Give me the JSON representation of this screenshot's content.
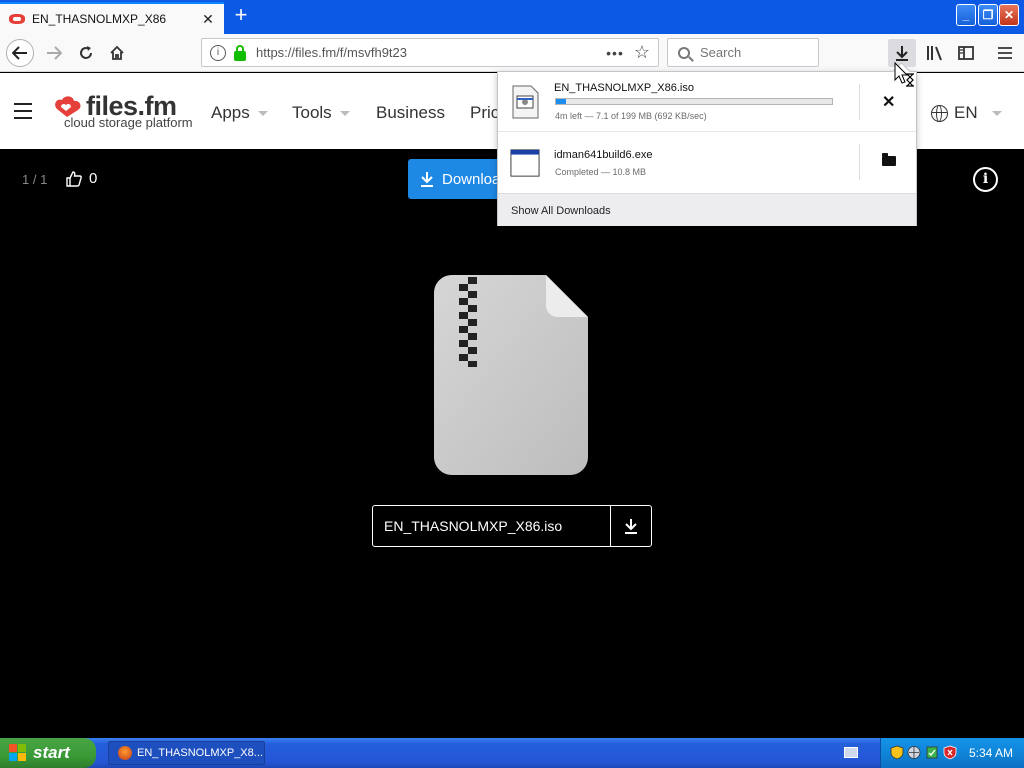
{
  "browser": {
    "tab_title": "EN_THASNOLMXP_X86",
    "tab_close": "✕",
    "new_tab": "+",
    "url": "https://files.fm/f/msvfh9t23",
    "url_more": "•••",
    "search_placeholder": "Search",
    "window_buttons": {
      "minimize": "_",
      "maximize": "❐",
      "close": "✕"
    }
  },
  "site": {
    "logo_name": "files.fm",
    "logo_tagline": "cloud storage platform",
    "nav": [
      {
        "label": "Apps"
      },
      {
        "label": "Tools"
      },
      {
        "label": "Business"
      },
      {
        "label": "Pric"
      }
    ],
    "language": "EN"
  },
  "viewer": {
    "counter": "1 / 1",
    "likes": "0",
    "download_label": "Downloa",
    "info": "i",
    "file_name": "EN_THASNOLMXP_X86.iso"
  },
  "downloads_panel": {
    "items": [
      {
        "name": "EN_THASNOLMXP_X86.iso",
        "status": "4m left — 7.1 of 199 MB (692 KB/sec)",
        "progress": 0.036,
        "action": "✕"
      },
      {
        "name": "idman641build6.exe",
        "status": "Completed — 10.8 MB"
      }
    ],
    "show_all": "Show All Downloads"
  },
  "taskbar": {
    "start": "start",
    "task_item": "EN_THASNOLMXP_X8...",
    "clock": "5:34 AM"
  },
  "colors": {
    "firefox_blue": "#0c59e6",
    "download_button": "#1e88e5",
    "progress_fill": "#1c8ef0",
    "logo_red": "#e5413a",
    "xp_start_green": "#3a9a36"
  }
}
